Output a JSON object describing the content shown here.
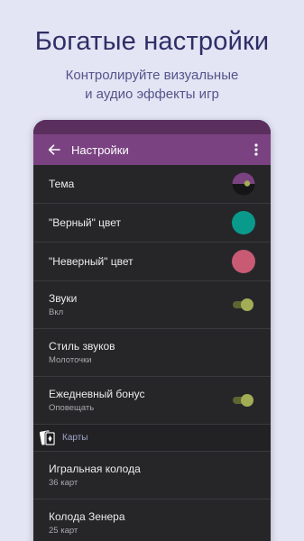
{
  "promo": {
    "headline": "Богатые настройки",
    "subline1": "Контролируйте визуальные",
    "subline2": "и аудио эффекты игр"
  },
  "appbar": {
    "title": "Настройки",
    "back_icon": "arrow-left-icon",
    "menu_icon": "more-vertical-icon"
  },
  "settings": {
    "theme": {
      "title": "Тема"
    },
    "right_color": {
      "title": "\"Верный\" цвет",
      "color": "#0a9a8b"
    },
    "wrong_color": {
      "title": "\"Неверный\" цвет",
      "color": "#c95a74"
    },
    "sounds": {
      "title": "Звуки",
      "value": "Вкл",
      "enabled": true
    },
    "sound_style": {
      "title": "Стиль звуков",
      "value": "Молоточки"
    },
    "daily_bonus": {
      "title": "Ежедневный бонус",
      "value": "Оповещать",
      "enabled": true
    }
  },
  "cards_section": {
    "label": "Карты",
    "icon": "playing-cards-icon",
    "items": [
      {
        "title": "Игральная колода",
        "value": "36 карт"
      },
      {
        "title": "Колода Зенера",
        "value": "25 карт"
      }
    ]
  },
  "colors": {
    "appbar": "#7a4281",
    "statusbar": "#5a2f5e",
    "background": "#e3e4f4",
    "panel": "#262629",
    "toggle_on": "#a3ad55"
  }
}
